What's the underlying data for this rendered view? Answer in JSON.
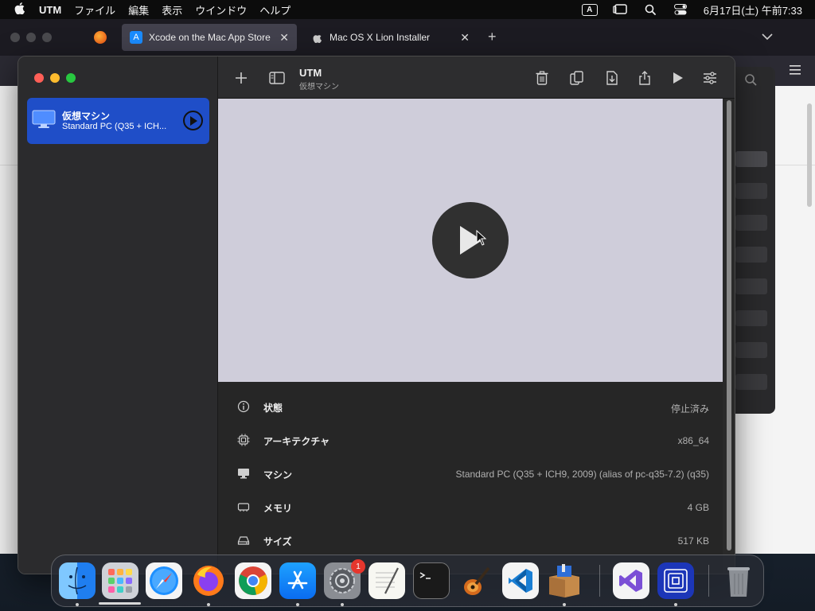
{
  "menubar": {
    "app_name": "UTM",
    "items": [
      "ファイル",
      "編集",
      "表示",
      "ウインドウ",
      "ヘルプ"
    ],
    "input_indicator": "A",
    "clock": "6月17日(土) 午前7:33"
  },
  "browser": {
    "tabs": [
      {
        "label": "Xcode on the Mac App Store",
        "active": true
      },
      {
        "label": "Mac OS X Lion Installer",
        "active": false
      }
    ],
    "new_tab": "+",
    "close_glyph": "✕"
  },
  "utm": {
    "title": "UTM",
    "subtitle": "仮想マシン",
    "vm": {
      "name": "仮想マシン",
      "description": "Standard PC (Q35 + ICH..."
    },
    "info": [
      {
        "icon": "info-icon",
        "label": "状態",
        "value": "停止済み"
      },
      {
        "icon": "cpu-icon",
        "label": "アーキテクチャ",
        "value": "x86_64"
      },
      {
        "icon": "display-icon",
        "label": "マシン",
        "value": "Standard PC (Q35 + ICH9, 2009) (alias of pc-q35-7.2) (q35)"
      },
      {
        "icon": "memory-icon",
        "label": "メモリ",
        "value": "4 GB"
      },
      {
        "icon": "drive-icon",
        "label": "サイズ",
        "value": "517 KB"
      }
    ]
  },
  "dock": {
    "items": [
      "Finder",
      "Launchpad",
      "Safari",
      "Firefox",
      "Chrome",
      "App Store",
      "System Settings",
      "TextEdit",
      "Terminal",
      "GarageBand",
      "VS Code",
      "Installer",
      "Visual Studio",
      "UTM",
      "Trash"
    ],
    "settings_badge": "1"
  },
  "colors": {
    "selection": "#1f4ec8",
    "preview_bg": "#cfcdda",
    "red": "#ff5f57",
    "yellow": "#febc2e",
    "green": "#28c840"
  }
}
